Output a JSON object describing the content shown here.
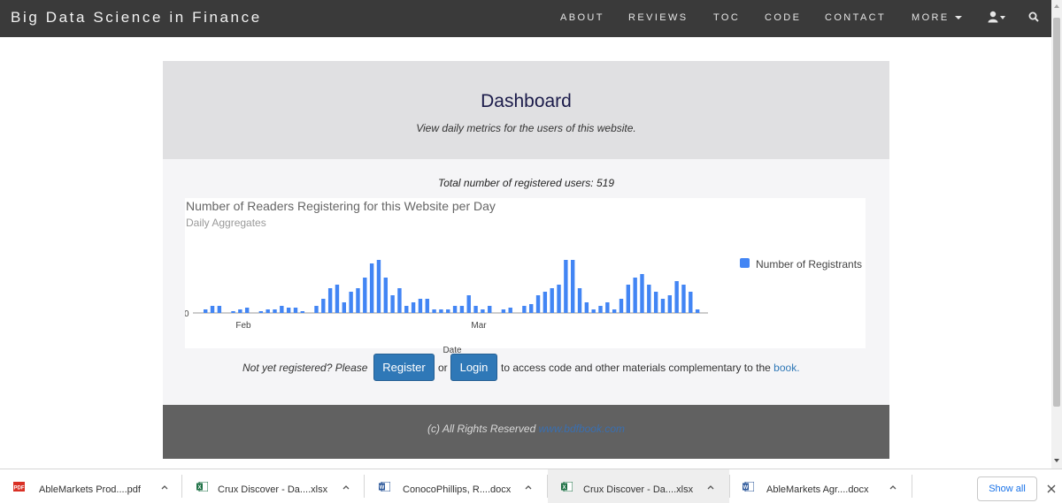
{
  "nav": {
    "brand": "Big Data Science in Finance",
    "items": [
      "ABOUT",
      "REVIEWS",
      "TOC",
      "CODE",
      "CONTACT",
      "MORE"
    ]
  },
  "header": {
    "title": "Dashboard",
    "subtitle": "View daily metrics for the users of this website."
  },
  "content": {
    "total_users": "Total number of registered users: 519"
  },
  "chart_data": {
    "type": "bar",
    "title": "Number of Readers Registering for this Website per Day",
    "subtitle": "Daily Aggregates",
    "xlabel": "Date",
    "ylabel": "",
    "y_tick_labels": [
      "0"
    ],
    "x_tick_labels": [
      "Feb",
      "Mar"
    ],
    "legend": "right",
    "series": [
      {
        "name": "Number of Registrants",
        "color": "#4285f4",
        "values": [
          1,
          2,
          2,
          0,
          0.5,
          1,
          1.5,
          0,
          0.5,
          1,
          1,
          2,
          1.5,
          1.5,
          0.5,
          0,
          2,
          4,
          7,
          8,
          3,
          6,
          7,
          10,
          14,
          15,
          10,
          5,
          7,
          2,
          3,
          4,
          4,
          1,
          1,
          1,
          2,
          2,
          5,
          2,
          1,
          2,
          0,
          1,
          1.5,
          0,
          2,
          2.5,
          5,
          6,
          7,
          8,
          15,
          15,
          7,
          3,
          1,
          2,
          3,
          1,
          4,
          8,
          10,
          11,
          8,
          6,
          4,
          5,
          9,
          8,
          6,
          1
        ]
      }
    ]
  },
  "cta": {
    "prefix": "Not yet registered? Please",
    "register": "Register",
    "or": "or",
    "login": "Login",
    "suffix": "to access code and other materials complementary to the",
    "book": "book."
  },
  "footer": {
    "text": "(c) All Rights Reserved",
    "link": "www.bdfbook.com"
  },
  "downloads": {
    "items": [
      {
        "name": "AbleMarkets Prod....pdf",
        "icon": "pdf-icon"
      },
      {
        "name": "Crux Discover - Da....xlsx",
        "icon": "excel-icon"
      },
      {
        "name": "ConocoPhillips, R....docx",
        "icon": "word-icon"
      },
      {
        "name": "Crux Discover - Da....xlsx",
        "icon": "excel-icon"
      },
      {
        "name": "AbleMarkets Agr....docx",
        "icon": "word-icon"
      }
    ],
    "show_all": "Show all"
  },
  "colors": {
    "navbar": "#3a3a3a",
    "accent": "#2f78b7",
    "bar": "#4285f4",
    "footer": "#616161"
  }
}
